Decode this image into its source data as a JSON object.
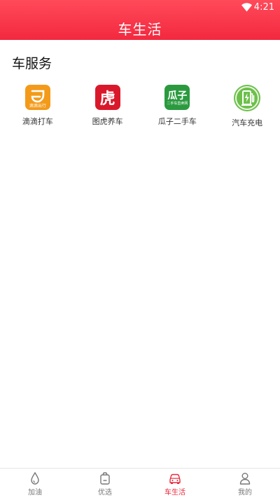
{
  "status_bar": {
    "time": "4:21",
    "wifi_icon": "wifi-icon"
  },
  "header": {
    "title": "车生活"
  },
  "section": {
    "title": "车服务"
  },
  "services": [
    {
      "label": "滴滴打车",
      "icon": "didi-app-icon",
      "icon_text": "滴滴出行"
    },
    {
      "label": "图虎养车",
      "icon": "tuhu-app-icon",
      "icon_text": "虎"
    },
    {
      "label": "瓜子二手车",
      "icon": "guazi-app-icon",
      "icon_text": "瓜子",
      "icon_subtext": "二手车直卖网"
    },
    {
      "label": "汽车充电",
      "icon": "charging-station-icon"
    }
  ],
  "tabbar": {
    "items": [
      {
        "label": "加油",
        "icon": "fuel-drop-icon",
        "active": false
      },
      {
        "label": "优选",
        "icon": "bag-icon",
        "active": false
      },
      {
        "label": "车生活",
        "icon": "car-icon",
        "active": true
      },
      {
        "label": "我的",
        "icon": "user-icon",
        "active": false
      }
    ]
  },
  "colors": {
    "brand_red": "#f3283f",
    "active_tab": "#e8283c"
  }
}
